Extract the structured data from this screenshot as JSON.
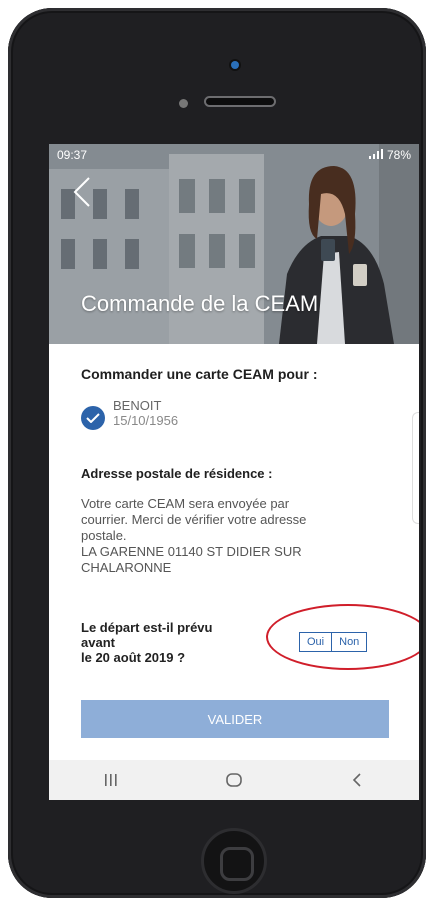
{
  "status_bar": {
    "time": "09:37",
    "battery": "78%"
  },
  "header": {
    "title": "Commande de la CEAM"
  },
  "order_section": {
    "title": "Commander une carte CEAM pour :",
    "person": {
      "name": "BENOIT",
      "birthdate": "15/10/1956"
    }
  },
  "address_section": {
    "title": "Adresse postale de résidence :",
    "lines": [
      "Votre carte CEAM sera envoyée par",
      "courrier. Merci de vérifier votre adresse",
      "postale.",
      "LA GARENNE 01140 ST DIDIER SUR",
      "CHALARONNE"
    ]
  },
  "departure_question": {
    "lines": [
      "Le départ est-il prévu",
      "avant",
      "le 20 août 2019 ?"
    ],
    "options": [
      "Oui",
      "Non"
    ]
  },
  "actions": {
    "validate_label": "VALIDER"
  },
  "colors": {
    "primary": "#2c63aa",
    "button_disabled": "#8eaed8",
    "highlight": "#d01e2a",
    "device_body": "#1f1f22"
  },
  "icons": [
    "back-arrow-icon",
    "checkmark-icon",
    "recent-apps-icon",
    "home-icon",
    "nav-back-icon"
  ]
}
